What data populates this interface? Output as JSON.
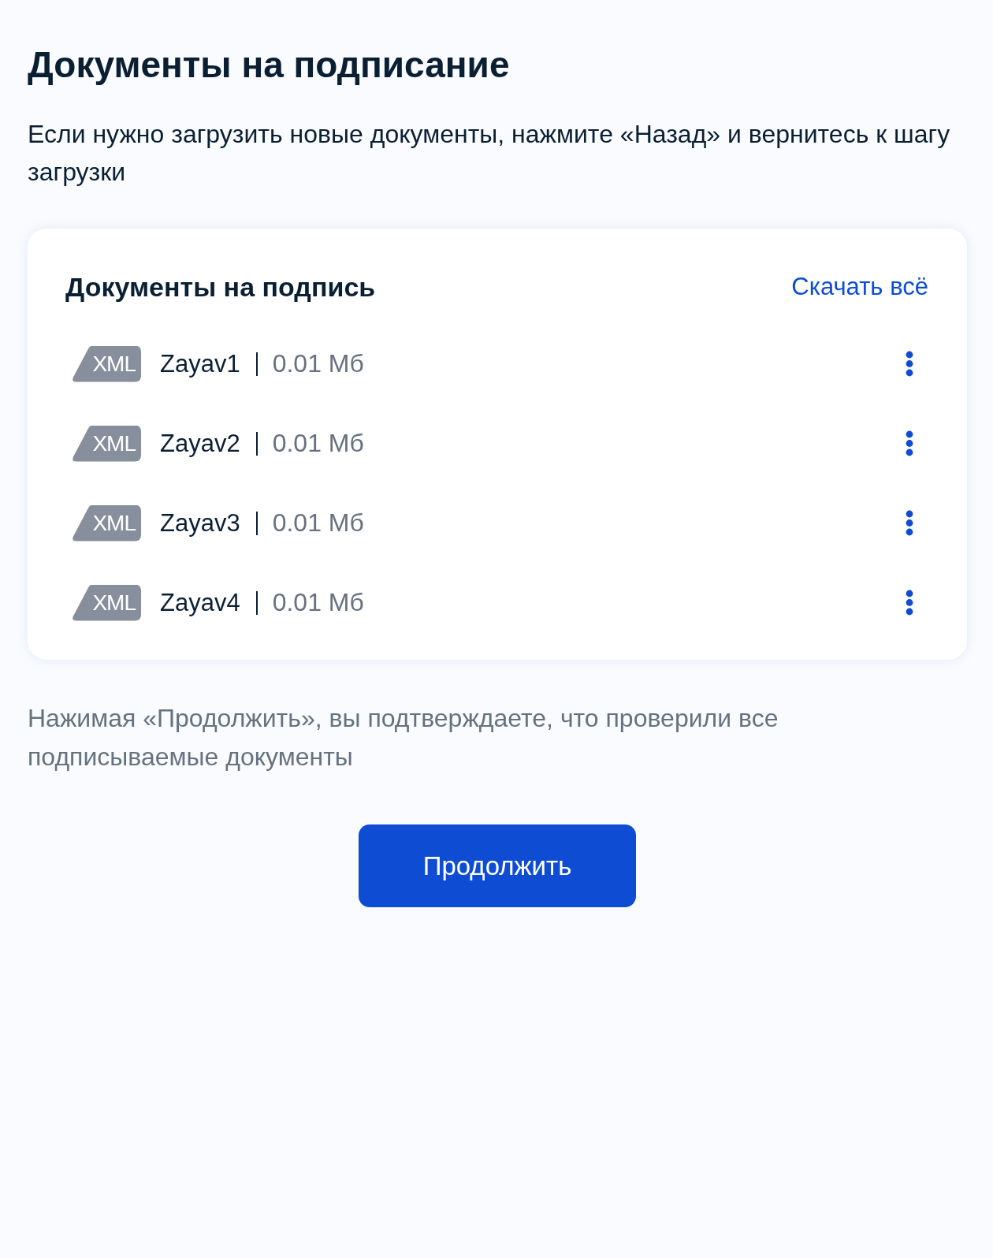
{
  "page": {
    "title": "Документы на подписание",
    "description": "Если нужно загрузить новые документы, нажмите «Назад» и вернитесь к шагу загрузки"
  },
  "card": {
    "title": "Документы на подпись",
    "download_all": "Скачать всё",
    "files": [
      {
        "type": "XML",
        "name": "Zayav1",
        "size": "0.01 Мб"
      },
      {
        "type": "XML",
        "name": "Zayav2",
        "size": "0.01 Мб"
      },
      {
        "type": "XML",
        "name": "Zayav3",
        "size": "0.01 Мб"
      },
      {
        "type": "XML",
        "name": "Zayav4",
        "size": "0.01 Мб"
      }
    ]
  },
  "notice": "Нажимая «Продолжить», вы подтверждаете, что проверили все подписываемые документы",
  "buttons": [
    {
      "label": "Продолжить"
    }
  ]
}
